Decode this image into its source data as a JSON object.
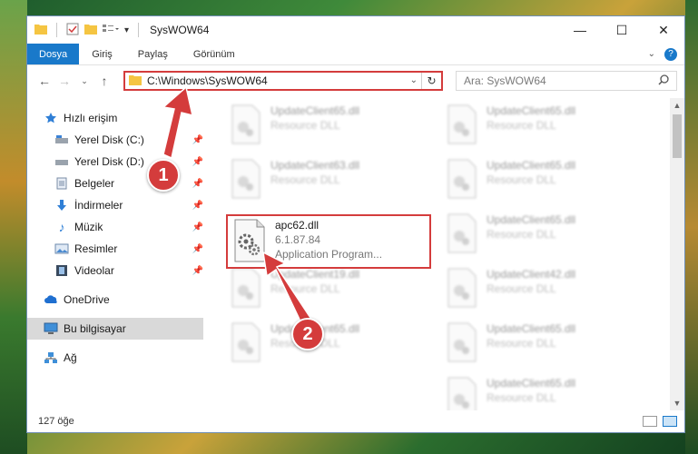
{
  "window": {
    "title": "SysWOW64"
  },
  "ribbon": {
    "tabs": [
      "Dosya",
      "Giriş",
      "Paylaş",
      "Görünüm"
    ]
  },
  "address": {
    "path": "C:\\Windows\\SysWOW64"
  },
  "search": {
    "placeholder": "Ara: SysWOW64"
  },
  "sidebar": {
    "quick_access": "Hızlı erişim",
    "items": [
      "Yerel Disk (C:)",
      "Yerel Disk (D:)",
      "Belgeler",
      "İndirmeler",
      "Müzik",
      "Resimler",
      "Videolar"
    ],
    "onedrive": "OneDrive",
    "this_pc": "Bu bilgisayar",
    "network": "Ağ"
  },
  "files": {
    "selected": {
      "name": "apc62.dll",
      "version": "6.1.87.84",
      "type": "Application Program..."
    },
    "blurred": [
      {
        "name": "UpdateClient65.dll",
        "desc": "Resource DLL"
      },
      {
        "name": "UpdateClient65.dll",
        "desc": "Resource DLL"
      },
      {
        "name": "UpdateClient63.dll",
        "desc": "Resource DLL"
      },
      {
        "name": "UpdateClient65.dll",
        "desc": "Resource DLL"
      },
      {
        "name": "UpdateClient65.dll",
        "desc": "Resource DLL"
      },
      {
        "name": "UpdateClient42.dll",
        "desc": "Resource DLL"
      },
      {
        "name": "UpdateClient19.dll",
        "desc": "Resource DLL"
      },
      {
        "name": "UpdateClient65.dll",
        "desc": "Resource DLL"
      },
      {
        "name": "UpdateClient65.dll",
        "desc": "Resource DLL"
      },
      {
        "name": "UpdateClient65.dll",
        "desc": "Resource DLL"
      }
    ]
  },
  "status": {
    "count": "127 öğe"
  },
  "callouts": {
    "one": "1",
    "two": "2"
  },
  "colors": {
    "accent": "#1979ca",
    "highlight": "#d43c3c"
  }
}
